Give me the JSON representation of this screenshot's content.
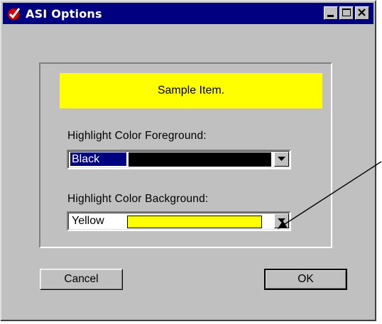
{
  "window": {
    "title": "ASI Options",
    "controls": {
      "minimize": "minimize",
      "maximize": "maximize",
      "close": "close"
    }
  },
  "sample": {
    "text": "Sample Item.",
    "color": "#ffff00"
  },
  "foreground": {
    "label": "Highlight Color Foreground:",
    "value": "Black",
    "swatch_color": "#000000"
  },
  "background": {
    "label": "Highlight Color Background:",
    "value": "Yellow",
    "swatch_color": "#ffff00"
  },
  "buttons": {
    "cancel": "Cancel",
    "ok": "OK"
  },
  "colors": {
    "titlebar": "#000080",
    "face": "#c0c0c0",
    "selection": "#000080"
  }
}
